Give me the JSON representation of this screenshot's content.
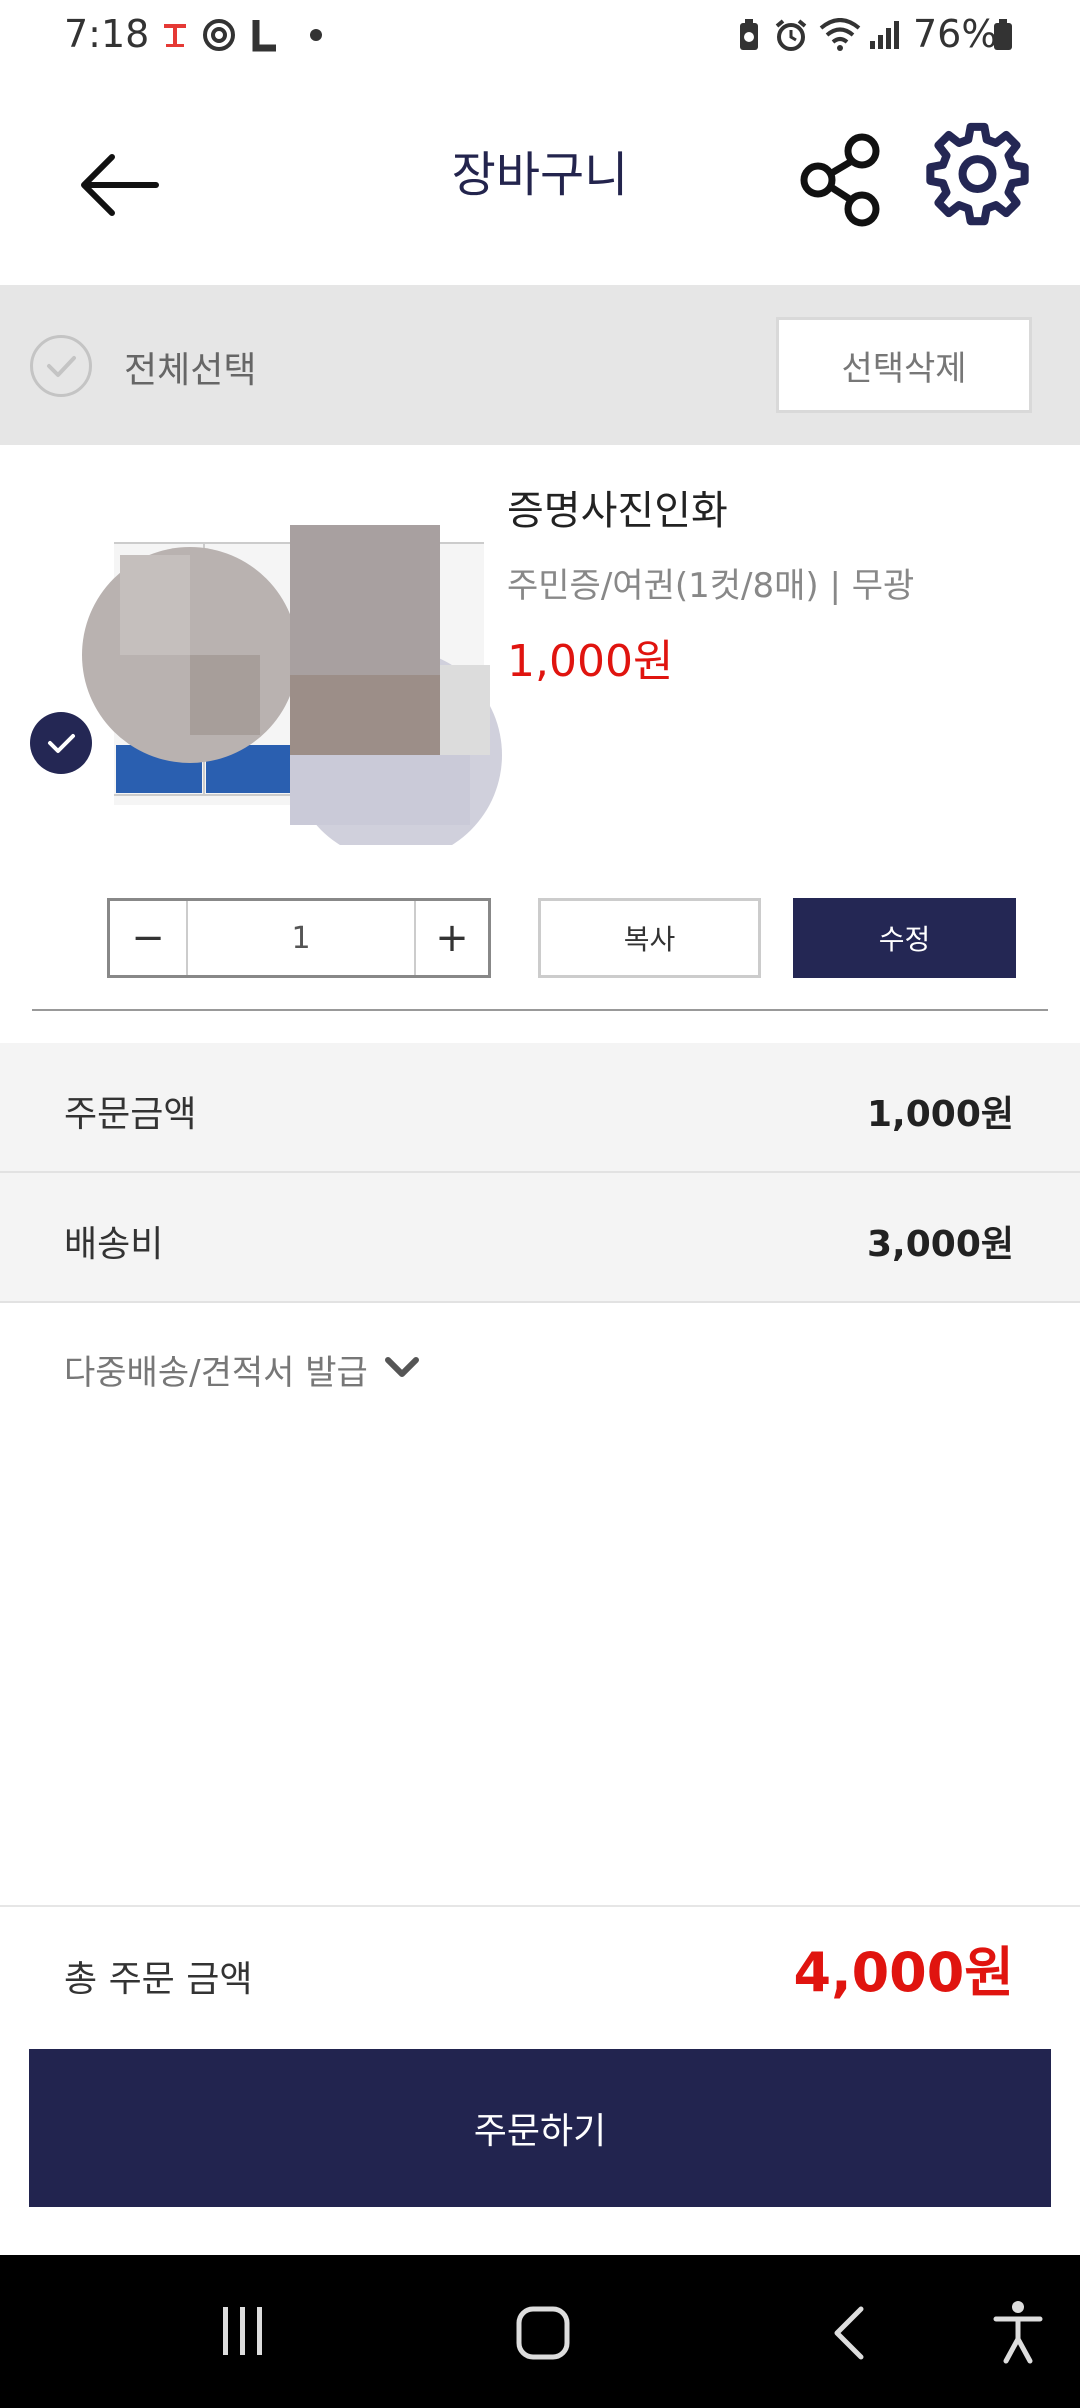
{
  "status_bar": {
    "time": "7:18",
    "battery_percent": "76%",
    "icons": [
      "t-icon",
      "target-icon",
      "l-icon",
      "dot-icon",
      "battery-save-icon",
      "alarm-icon",
      "wifi-icon",
      "signal-icon",
      "battery-icon"
    ]
  },
  "header": {
    "title": "장바구니",
    "icons": [
      "back-arrow-icon",
      "share-icon",
      "gear-icon"
    ]
  },
  "select_bar": {
    "select_all_label": "전체선택",
    "delete_selected_label": "선택삭제",
    "select_all_checked": false
  },
  "cart_item": {
    "name": "증명사진인화",
    "options": "주민증/여권(1컷/8매) | 무광",
    "price": "1,000원",
    "checked": true,
    "quantity": "1",
    "minus_label": "−",
    "plus_label": "+",
    "copy_label": "복사",
    "edit_label": "수정"
  },
  "summary": {
    "order_amount_label": "주문금액",
    "order_amount_value": "1,000원",
    "shipping_label": "배송비",
    "shipping_value": "3,000원",
    "multi_shipping_label": "다중배송/견적서 발급"
  },
  "total": {
    "label": "총 주문 금액",
    "value": "4,000원"
  },
  "order_button": "주문하기",
  "colors": {
    "navy": "#242754",
    "price_red": "#e0140f",
    "bar_gray": "#e6e6e6"
  },
  "nav_bar": {
    "icons": [
      "recent-apps-icon",
      "home-icon",
      "back-icon",
      "accessibility-icon"
    ]
  }
}
